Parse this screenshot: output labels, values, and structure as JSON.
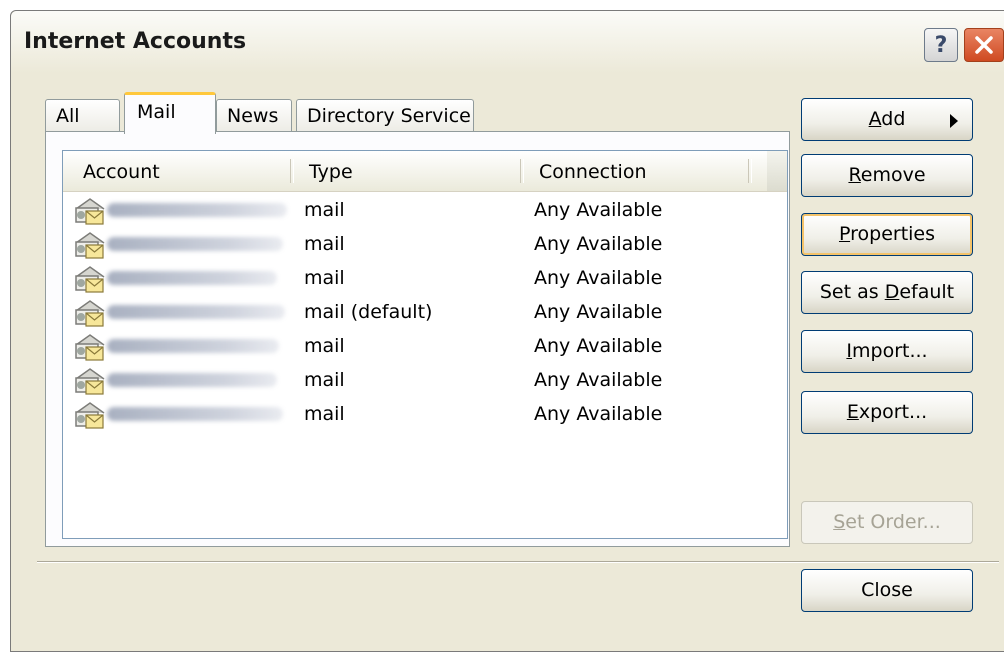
{
  "window": {
    "title": "Internet Accounts",
    "help_label": "?"
  },
  "tabs": [
    {
      "label": "All",
      "active": false
    },
    {
      "label": "Mail",
      "active": true
    },
    {
      "label": "News",
      "active": false
    },
    {
      "label": "Directory Service",
      "active": false
    }
  ],
  "list": {
    "columns": [
      "Account",
      "Type",
      "Connection"
    ],
    "rows": [
      {
        "type": "mail",
        "connection": "Any Available"
      },
      {
        "type": "mail",
        "connection": "Any Available"
      },
      {
        "type": "mail",
        "connection": "Any Available"
      },
      {
        "type": "mail (default)",
        "connection": "Any Available"
      },
      {
        "type": "mail",
        "connection": "Any Available"
      },
      {
        "type": "mail",
        "connection": "Any Available"
      },
      {
        "type": "mail",
        "connection": "Any Available"
      }
    ],
    "row_icon": "mail-account-icon"
  },
  "buttons": {
    "add": {
      "pre": "",
      "ul": "A",
      "post": "dd"
    },
    "remove": {
      "pre": "",
      "ul": "R",
      "post": "emove"
    },
    "properties": {
      "pre": "",
      "ul": "P",
      "post": "roperties"
    },
    "set_default": {
      "pre": "Set as ",
      "ul": "D",
      "post": "efault"
    },
    "import": {
      "pre": "",
      "ul": "I",
      "post": "mport..."
    },
    "export": {
      "pre": "",
      "ul": "E",
      "post": "xport..."
    },
    "set_order": {
      "pre": "",
      "ul": "S",
      "post": "et Order..."
    },
    "close": {
      "pre": "",
      "ul": "",
      "post": "Close"
    }
  },
  "colors": {
    "dialog_bg": "#ece9d8",
    "button_border": "#003c74",
    "focus_ring": "#f4c36a",
    "tab_highlight": "#ffc83c",
    "close_button": "#cf4a22"
  }
}
